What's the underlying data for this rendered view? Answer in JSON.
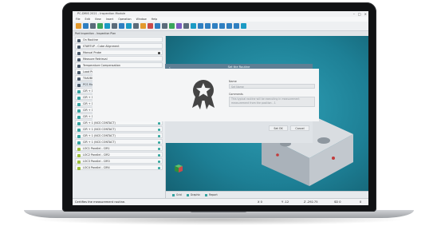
{
  "window": {
    "title": "PC-DMIS 2021 - Inspection Module",
    "controls": [
      "–",
      "□",
      "×"
    ]
  },
  "menubar": [
    "File",
    "Edit",
    "View",
    "Insert",
    "Operation",
    "Window",
    "Help"
  ],
  "tabstrip": {
    "label": "Part Inspection - Inspection Plan"
  },
  "sidebar": {
    "items": [
      {
        "label": "On Routine",
        "icon": "routine-icon",
        "dot": false
      },
      {
        "label": "STARTUP - Cube Alignment",
        "icon": "probe-icon",
        "dot": false
      },
      {
        "label": "Manual Probe",
        "icon": "hand-icon",
        "dot": true
      },
      {
        "label": "Measure Retrieval",
        "icon": "gear-icon",
        "dot": false
      },
      {
        "label": "Temperature Compensation",
        "icon": "gear-icon",
        "dot": false
      },
      {
        "label": "Load Probe - 0/0",
        "icon": "gear-icon",
        "dot": false
      },
      {
        "label": "T0A0B0 + 3Z Stylus Tip",
        "icon": "gear-icon",
        "dot": false
      },
      {
        "label": "PCS Moves",
        "icon": "gear-icon",
        "dot": true
      },
      {
        "label": "CIR + 1 (NCS CONTACT)",
        "icon": "circle-feature-icon",
        "dot": true
      },
      {
        "label": "CIR + 1 (NCS CONTACT)",
        "icon": "circle-feature-icon",
        "dot": true
      },
      {
        "label": "CIR + 1 (NCS CONTACT)",
        "icon": "circle-feature-icon",
        "dot": true
      },
      {
        "label": "CIR + 1 (NCS CONTACT)",
        "icon": "circle-feature-icon",
        "dot": true
      },
      {
        "label": "CIR + 1 (NCS CONTACT)",
        "icon": "circle-feature-icon",
        "dot": true
      },
      {
        "label": "CIR + 1 (NCS CONTACT)",
        "icon": "circle-feature-icon",
        "dot": true
      },
      {
        "label": "CIR + 1 (NCS CONTACT)",
        "icon": "circle-feature-icon",
        "dot": true
      },
      {
        "label": "CIR + 1 (NCS CONTACT)",
        "icon": "circle-feature-icon",
        "dot": true
      },
      {
        "label": "CIR + 1 (NCS CONTACT)",
        "icon": "circle-feature-icon",
        "dot": true
      },
      {
        "label": "LOC1 Parallel - CIR1",
        "icon": "dimension-icon",
        "dot": true
      },
      {
        "label": "LOC2 Parallel - CIR2",
        "icon": "dimension-icon",
        "dot": true
      },
      {
        "label": "LOC3 Parallel - CIR3",
        "icon": "dimension-icon",
        "dot": true
      },
      {
        "label": "LOC4 Parallel - CIR4",
        "icon": "dimension-icon",
        "dot": true
      }
    ]
  },
  "viewport_tabs": [
    {
      "label": "Grid"
    },
    {
      "label": "Graphic"
    },
    {
      "label": "Report"
    }
  ],
  "dialog": {
    "title": "Set the Routine",
    "back_glyph": "‹",
    "name_label": "Name",
    "name_placeholder": "Set Name",
    "comment_label": "Comments",
    "comment_text": "This typical routine will be executing in measurement measurement from the position - 1",
    "ok_label": "Set OK",
    "cancel_label": "Cancel"
  },
  "statusbar": {
    "message": "Certifies the measurement routine.",
    "x": "X 0",
    "y": "Y -12",
    "z": "Z -292.75",
    "sd": "SD 0",
    "last": "0"
  }
}
